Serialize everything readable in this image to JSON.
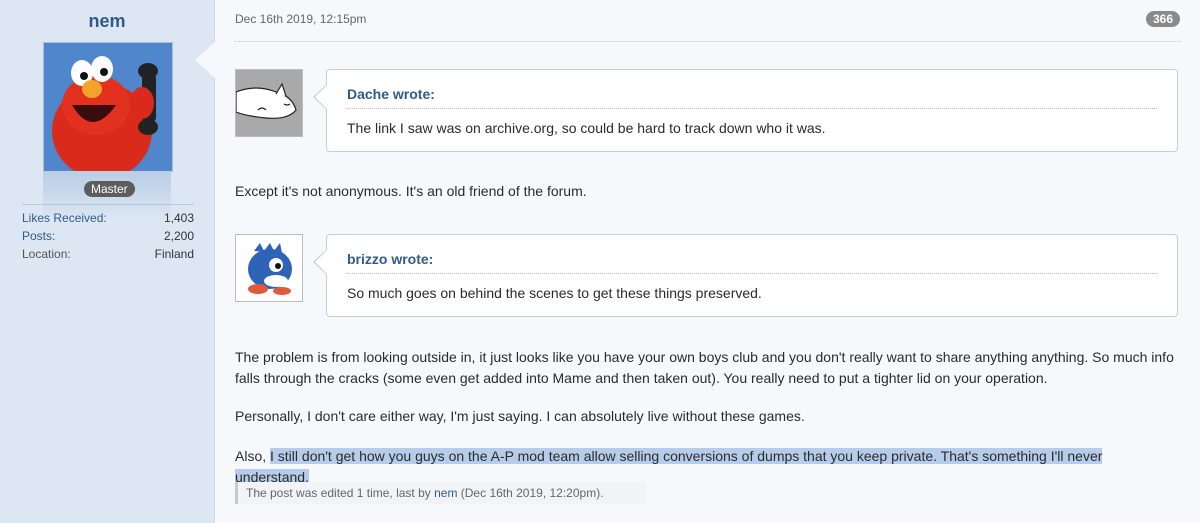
{
  "user": {
    "name": "nem",
    "rank": "Master",
    "stats": [
      {
        "label": "Likes Received:",
        "value": "1,403"
      },
      {
        "label": "Posts:",
        "value": "2,200"
      },
      {
        "label": "Location:",
        "value": "Finland"
      }
    ]
  },
  "post": {
    "date": "Dec 16th 2019, 12:15pm",
    "number": "366",
    "quotes": [
      {
        "author": "Dache wrote:",
        "text": "The link I saw was on archive.org, so could be hard to track down who it was."
      },
      {
        "author": "brizzo wrote:",
        "text": "So much goes on behind the scenes to get these things preserved."
      }
    ],
    "reply1": "Except it's not anonymous. It's an old friend of the forum.",
    "reply2": "The problem is from looking outside in, it just looks like you have your own boys club and you don't really want to share anything anything. So much info falls through the cracks (some even get added into Mame and then taken out). You really need to put a tighter lid on your operation.",
    "reply3": "Personally, I don't care either way, I'm just saying. I can absolutely live without these games.",
    "reply4_prefix": "Also, ",
    "reply4_highlight": "I still don't get how you guys on the A-P mod team allow selling conversions of dumps that you keep private. That's something I'll never understand.",
    "edited": {
      "prefix": "The post was edited 1 time, last by ",
      "user": "nem",
      "suffix": " (Dec 16th 2019, 12:20pm)."
    }
  }
}
